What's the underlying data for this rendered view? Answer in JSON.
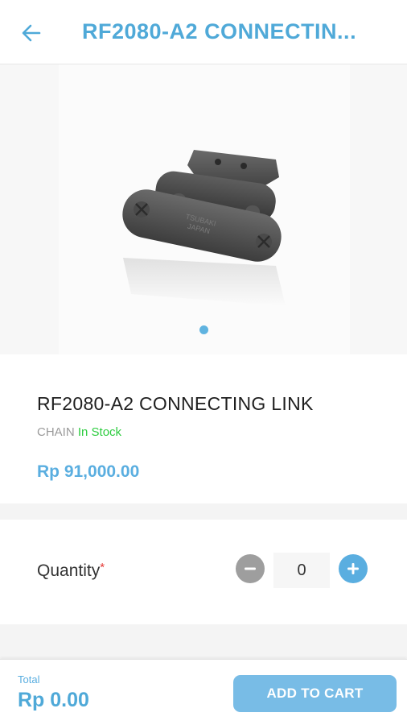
{
  "header": {
    "title": "RF2080-A2 CONNECTIN...",
    "back_icon": "arrow-left-icon"
  },
  "gallery": {
    "image_alt": "RF2080-A2 connecting link chain attachment",
    "engraving_line1": "TSUBAKI",
    "engraving_line2": "JAPAN",
    "page_count": 1,
    "active_index": 0
  },
  "product": {
    "name": "RF2080-A2 CONNECTING LINK",
    "category": "CHAIN",
    "stock_status": "In Stock",
    "price": "Rp 91,000.00"
  },
  "quantity": {
    "label": "Quantity",
    "required_mark": "*",
    "value": "0",
    "minus_icon": "minus-circle-icon",
    "plus_icon": "plus-circle-icon"
  },
  "footer": {
    "total_label": "Total",
    "total_value": "Rp 0.00",
    "cart_button_label": "ADD TO CART"
  },
  "colors": {
    "accent": "#5aaee0",
    "stock": "#2ecc40",
    "required": "#e53935"
  }
}
